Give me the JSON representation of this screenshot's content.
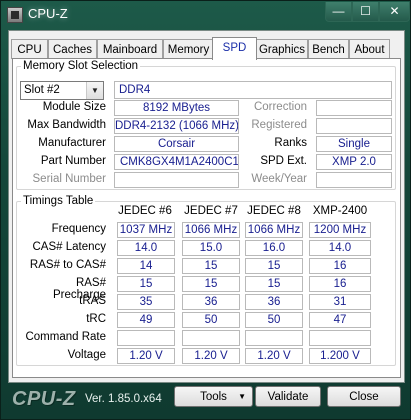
{
  "window": {
    "title": "CPU-Z",
    "controls": {
      "minimize": "—",
      "maximize": "☐",
      "close": "✕"
    }
  },
  "tabs": [
    "CPU",
    "Caches",
    "Mainboard",
    "Memory",
    "SPD",
    "Graphics",
    "Bench",
    "About"
  ],
  "active_tab": "SPD",
  "slot_section": {
    "legend": "Memory Slot Selection",
    "slot_selected": "Slot #2",
    "memory_type": "DDR4",
    "module_size_label": "Module Size",
    "module_size": "8192 MBytes",
    "max_bandwidth_label": "Max Bandwidth",
    "max_bandwidth": "DDR4-2132 (1066 MHz)",
    "manufacturer_label": "Manufacturer",
    "manufacturer": "Corsair",
    "part_number_label": "Part Number",
    "part_number": "CMK8GX4M1A2400C14",
    "serial_number_label": "Serial Number",
    "serial_number": "",
    "correction_label": "Correction",
    "correction": "",
    "registered_label": "Registered",
    "registered": "",
    "ranks_label": "Ranks",
    "ranks": "Single",
    "spd_ext_label": "SPD Ext.",
    "spd_ext": "XMP 2.0",
    "week_year_label": "Week/Year",
    "week_year": ""
  },
  "timings": {
    "legend": "Timings Table",
    "columns": [
      "JEDEC #6",
      "JEDEC #7",
      "JEDEC #8",
      "XMP-2400"
    ],
    "rows": [
      {
        "label": "Frequency",
        "values": [
          "1037 MHz",
          "1066 MHz",
          "1066 MHz",
          "1200 MHz"
        ]
      },
      {
        "label": "CAS# Latency",
        "values": [
          "14.0",
          "15.0",
          "16.0",
          "14.0"
        ]
      },
      {
        "label": "RAS# to CAS#",
        "values": [
          "14",
          "15",
          "15",
          "16"
        ]
      },
      {
        "label": "RAS# Precharge",
        "values": [
          "15",
          "15",
          "15",
          "16"
        ]
      },
      {
        "label": "tRAS",
        "values": [
          "35",
          "36",
          "36",
          "31"
        ]
      },
      {
        "label": "tRC",
        "values": [
          "49",
          "50",
          "50",
          "47"
        ]
      },
      {
        "label": "Command Rate",
        "values": [
          "",
          "",
          "",
          ""
        ]
      },
      {
        "label": "Voltage",
        "values": [
          "1.20 V",
          "1.20 V",
          "1.20 V",
          "1.200 V"
        ]
      }
    ]
  },
  "footer": {
    "logo": "CPU-Z",
    "version": "Ver. 1.85.0.x64",
    "tools_label": "Tools",
    "validate_label": "Validate",
    "close_label": "Close"
  }
}
